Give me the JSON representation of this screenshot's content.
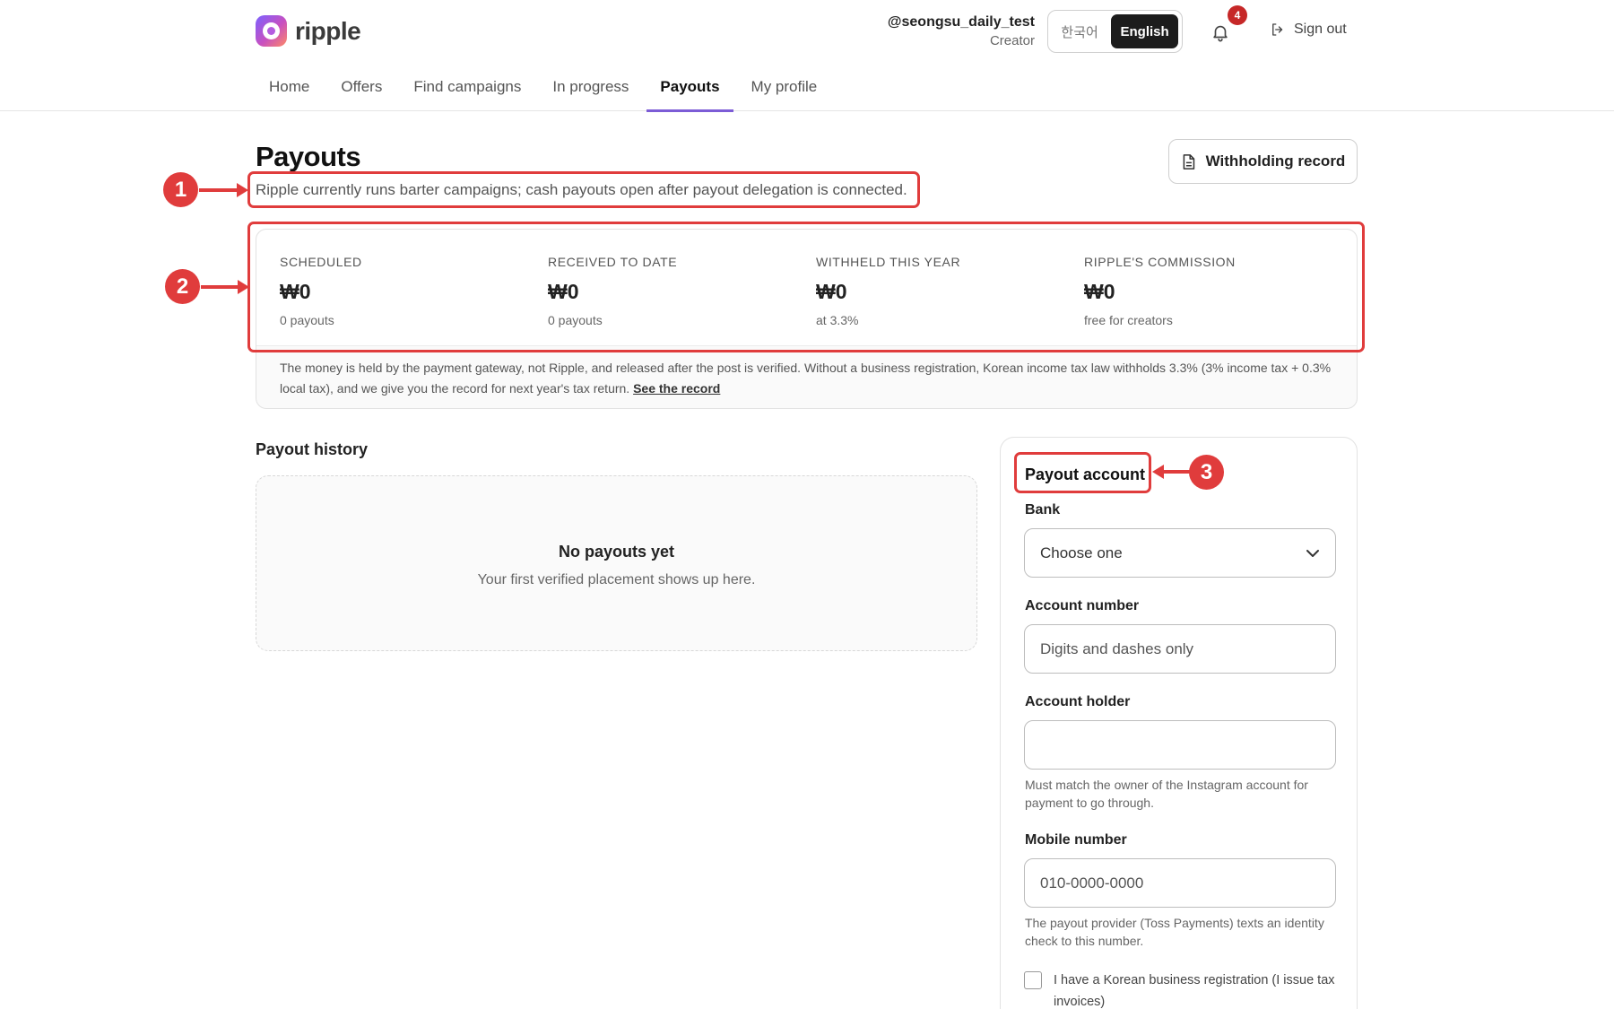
{
  "header": {
    "logo_text": "ripple",
    "user_handle": "@seongsu_daily_test",
    "user_role": "Creator",
    "lang_ko": "한국어",
    "lang_en": "English",
    "notification_count": "4",
    "signout_label": "Sign out"
  },
  "nav": {
    "items": [
      "Home",
      "Offers",
      "Find campaigns",
      "In progress",
      "Payouts",
      "My profile"
    ],
    "active": "Payouts"
  },
  "page": {
    "title": "Payouts",
    "subtitle": "Ripple currently runs barter campaigns; cash payouts open after payout delegation is connected.",
    "withholding_button": "Withholding record"
  },
  "stats": [
    {
      "label": "SCHEDULED",
      "value": "₩0",
      "sub": "0 payouts"
    },
    {
      "label": "RECEIVED TO DATE",
      "value": "₩0",
      "sub": "0 payouts"
    },
    {
      "label": "WITHHELD THIS YEAR",
      "value": "₩0",
      "sub": "at 3.3%"
    },
    {
      "label": "RIPPLE'S COMMISSION",
      "value": "₩0",
      "sub": "free for creators"
    }
  ],
  "stats_note": {
    "text": "The money is held by the payment gateway, not Ripple, and released after the post is verified. Without a business registration, Korean income tax law withholds 3.3% (3% income tax + 0.3% local tax), and we give you the record for next year's tax return.",
    "link": "See the record"
  },
  "history": {
    "title": "Payout history",
    "empty_title": "No payouts yet",
    "empty_sub": "Your first verified placement shows up here."
  },
  "account": {
    "title": "Payout account",
    "bank_label": "Bank",
    "bank_value": "Choose one",
    "account_number_label": "Account number",
    "account_number_placeholder": "Digits and dashes only",
    "holder_label": "Account holder",
    "holder_value": "",
    "holder_helper": "Must match the owner of the Instagram account for payment to go through.",
    "mobile_label": "Mobile number",
    "mobile_placeholder": "010-0000-0000",
    "mobile_helper": "The payout provider (Toss Payments) texts an identity check to this number.",
    "business_checkbox": "I have a Korean business registration (I issue tax invoices)"
  },
  "annotations": [
    "1",
    "2",
    "3"
  ],
  "colors": {
    "accent": "#7c5cd6",
    "annotation": "#e03c3c",
    "badge": "#c62828"
  }
}
